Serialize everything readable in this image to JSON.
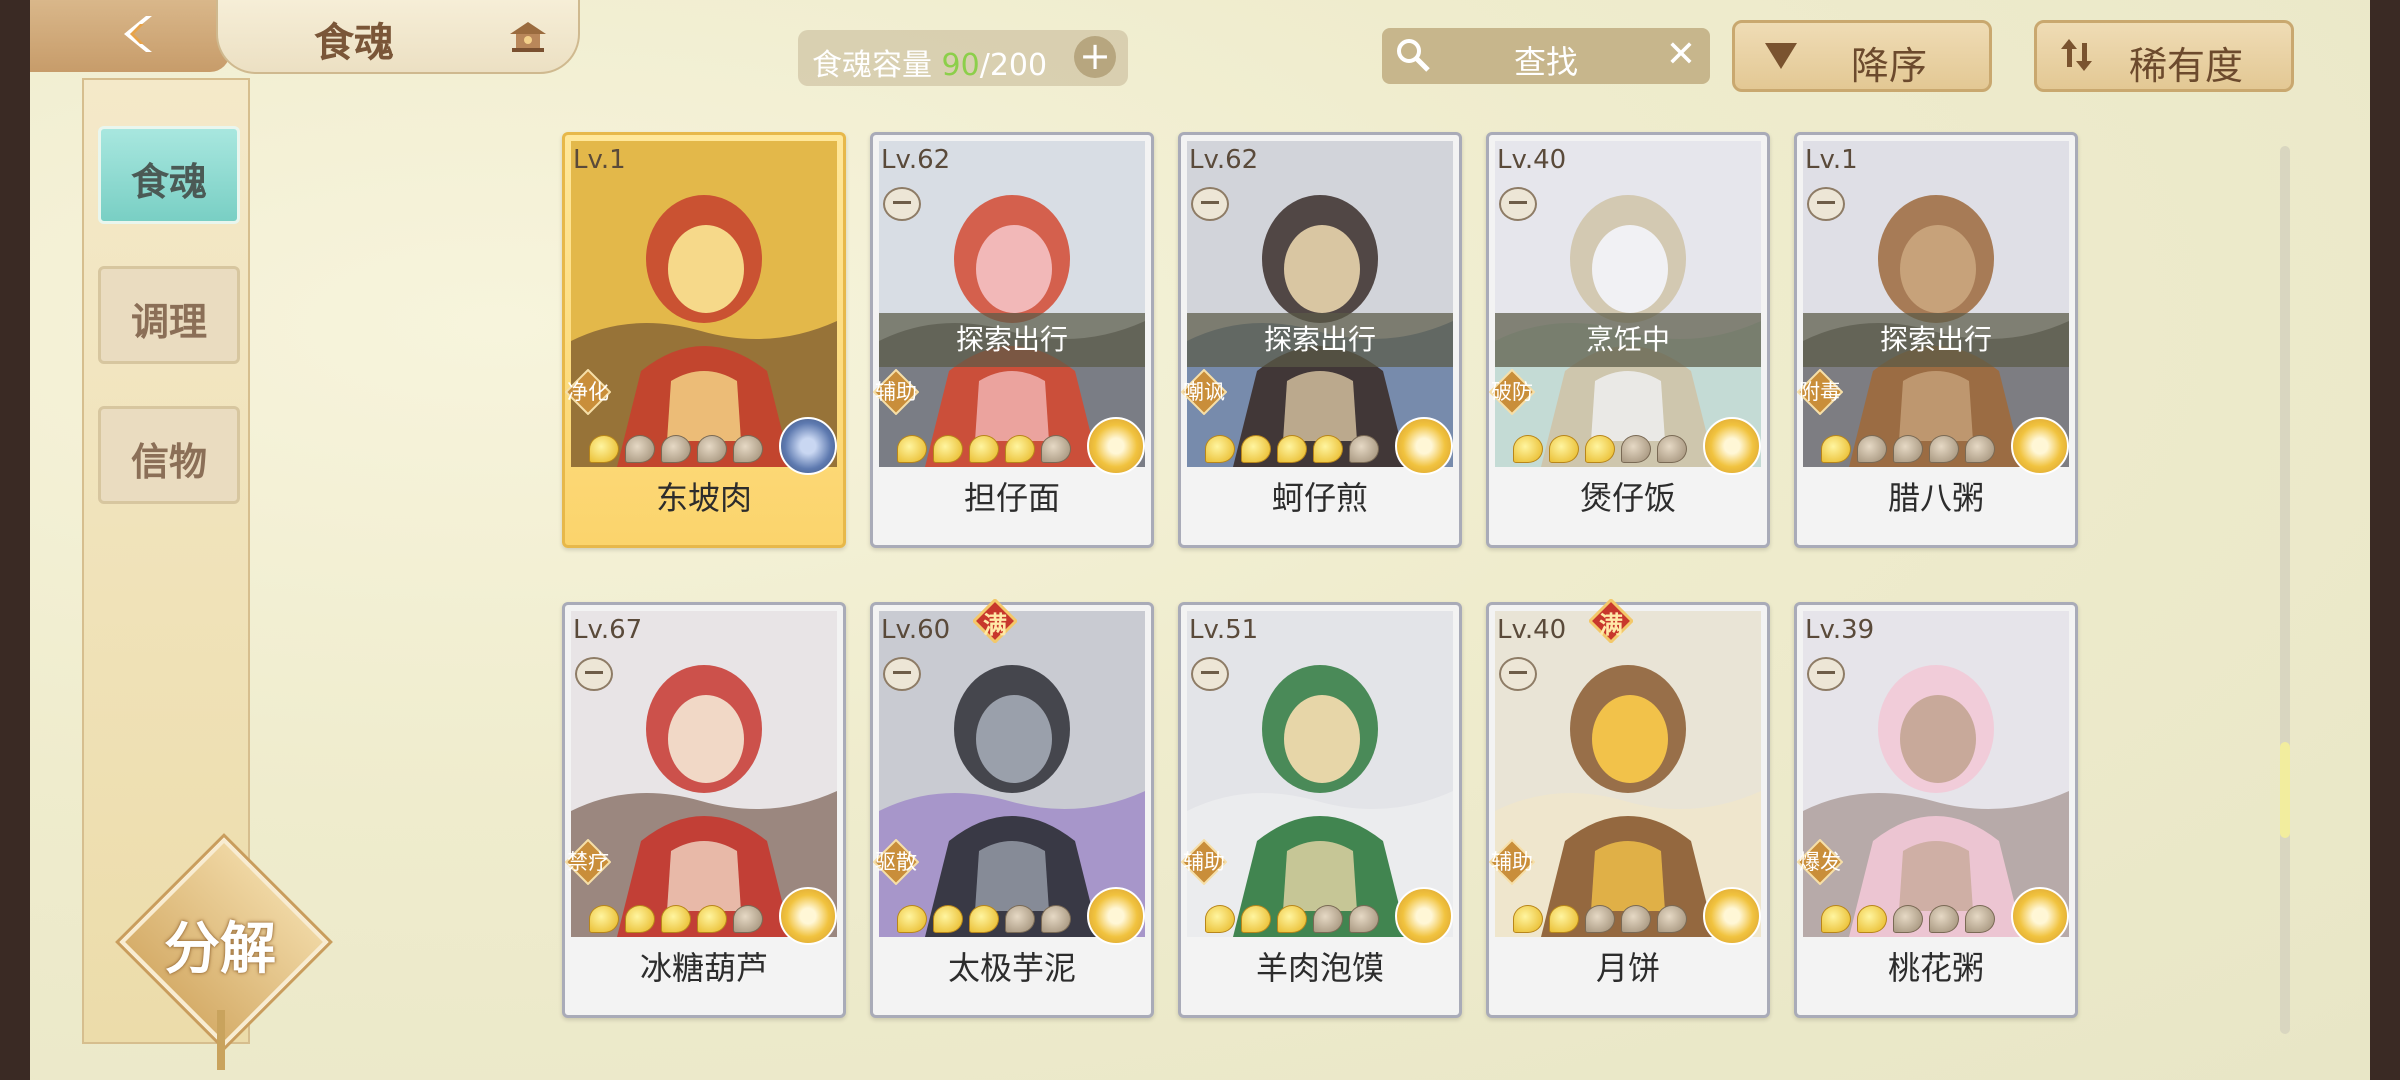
{
  "header": {
    "title": "食魂",
    "capacity": {
      "label": "食魂容量",
      "current": "90",
      "sep": "/",
      "max": "200",
      "plus": "+"
    },
    "search": {
      "label": "查找",
      "clear": "✕"
    },
    "sort_order_label": "降序",
    "sort_by_label": "稀有度"
  },
  "sidebar": {
    "tabs": [
      {
        "label": "食魂"
      },
      {
        "label": "调理"
      },
      {
        "label": "信物"
      }
    ],
    "decompose_label": "分解"
  },
  "colors": {
    "dot_on": "#e6b41e",
    "dot_off": "#9b8a72",
    "gold_frame": "#fbd46c",
    "teal_tab": "#79cfc4"
  },
  "cards": [
    {
      "name": "东坡肉",
      "level": "Lv.1",
      "role": "净化",
      "status": "",
      "full": "",
      "stars": 1,
      "highlight": true,
      "medal": "blue",
      "theme": [
        "#e3b84a",
        "#f6d98a",
        "#c6402e",
        "#5a3a2a"
      ]
    },
    {
      "name": "担仔面",
      "level": "Lv.62",
      "role": "辅助",
      "status": "探索出行",
      "full": "",
      "stars": 4,
      "highlight": false,
      "medal": "gold",
      "theme": [
        "#d8dde4",
        "#f2b8b8",
        "#d44a32",
        "#2e2e36"
      ]
    },
    {
      "name": "蚵仔煎",
      "level": "Lv.62",
      "role": "嘲讽",
      "status": "探索出行",
      "full": "",
      "stars": 4,
      "highlight": false,
      "medal": "gold",
      "theme": [
        "#d2d4da",
        "#d9c6a2",
        "#3b2e2a",
        "#2c4f86"
      ]
    },
    {
      "name": "煲仔饭",
      "level": "Lv.40",
      "role": "破防",
      "status": "烹饪中",
      "full": "",
      "stars": 3,
      "highlight": false,
      "medal": "gold",
      "theme": [
        "#e6e6ec",
        "#f1f1f4",
        "#cfc3a8",
        "#a8d1c2"
      ]
    },
    {
      "name": "腊八粥",
      "level": "Lv.1",
      "role": "附毒",
      "status": "探索出行",
      "full": "",
      "stars": 1,
      "highlight": false,
      "medal": "gold",
      "theme": [
        "#dfdfe6",
        "#c7a27a",
        "#9e6a3c",
        "#2b2b2f"
      ]
    },
    {
      "name": "冰糖葫芦",
      "level": "Lv.67",
      "role": "禁疗",
      "status": "",
      "full": "",
      "stars": 4,
      "highlight": false,
      "medal": "gold",
      "theme": [
        "#e8e4e6",
        "#f1d8c6",
        "#c7372f",
        "#5b3a2a"
      ]
    },
    {
      "name": "太极芋泥",
      "level": "Lv.60",
      "role": "驱散",
      "status": "",
      "full": "满",
      "stars": 3,
      "highlight": false,
      "medal": "gold",
      "theme": [
        "#c9cbd2",
        "#9aa0ab",
        "#2e2f36",
        "#8a6bc3"
      ]
    },
    {
      "name": "羊肉泡馍",
      "level": "Lv.51",
      "role": "辅助",
      "status": "",
      "full": "",
      "stars": 3,
      "highlight": false,
      "medal": "gold",
      "theme": [
        "#e3e4e8",
        "#e7d6a8",
        "#2f7a3e",
        "#f2f2f2"
      ]
    },
    {
      "name": "月饼",
      "level": "Lv.40",
      "role": "辅助",
      "status": "",
      "full": "满",
      "stars": 2,
      "highlight": false,
      "medal": "gold",
      "theme": [
        "#e9e4d6",
        "#f2c24a",
        "#8a5a30",
        "#f4e7c6"
      ]
    },
    {
      "name": "桃花粥",
      "level": "Lv.39",
      "role": "爆发",
      "status": "",
      "full": "",
      "stars": 2,
      "highlight": false,
      "medal": "gold",
      "theme": [
        "#e6e4ea",
        "#c8a99a",
        "#f2c8d6",
        "#8f7a72"
      ]
    }
  ]
}
